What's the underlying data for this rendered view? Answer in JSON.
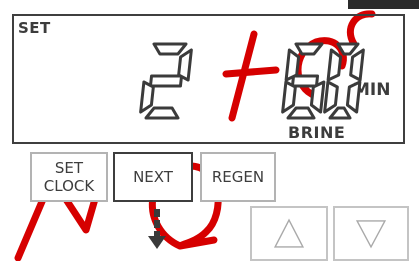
{
  "display": {
    "mode_label": "SET",
    "primary_value": "2",
    "secondary_value": "60",
    "unit": "MIN",
    "sub_label": "BRINE"
  },
  "buttons": {
    "set_clock": [
      "SET",
      "CLOCK"
    ],
    "next": "NEXT",
    "regen": "REGEN",
    "up": "up-arrow-icon",
    "down": "down-arrow-icon"
  },
  "indicator_icon": "down-arrow-icon",
  "colors": {
    "watermark": "#d60000",
    "segment_outline": "#3b3b3b",
    "active_border": "#3e3e3e",
    "inactive_border": "#b3b3b3"
  }
}
